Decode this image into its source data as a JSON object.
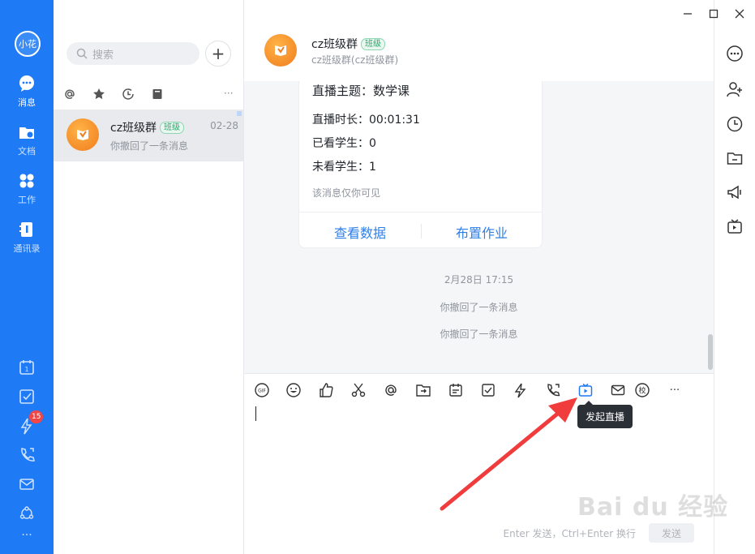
{
  "nav": {
    "avatar": "小花",
    "items": [
      {
        "label": "消息",
        "icon": "chat-bubble-icon",
        "active": true
      },
      {
        "label": "文档",
        "icon": "folder-icon"
      },
      {
        "label": "工作",
        "icon": "grid-apps-icon"
      },
      {
        "label": "通讯录",
        "icon": "contacts-book-icon"
      }
    ],
    "bottom_icons": [
      "calendar-icon",
      "todo-check-icon",
      "lightning-icon",
      "phone-icon",
      "mail-icon",
      "network-icon",
      "more-dots-icon"
    ],
    "calendar_day": "1",
    "badge_count": "15",
    "more": "···"
  },
  "list": {
    "search_placeholder": "搜索",
    "add_label": "+",
    "more_label": "···",
    "session": {
      "name": "cz班级群",
      "tag": "班级",
      "time": "02-28",
      "preview": "你撤回了一条消息"
    }
  },
  "chat": {
    "title": "cz班级群",
    "tag": "班级",
    "subtitle": "cz班级群(cz班级群)",
    "card": {
      "topic": "直播主题：数学课",
      "duration": "直播时长：00:01:31",
      "watched": "已看学生：0",
      "unwatched": "未看学生：1",
      "note": "该消息仅你可见",
      "action_data": "查看数据",
      "action_homework": "布置作业"
    },
    "timestamp": "2月28日 17:15",
    "recall_1": "你撤回了一条消息",
    "recall_2": "你撤回了一条消息",
    "tooltip": "发起直播",
    "hint": "Enter 发送，Ctrl+Enter 换行",
    "send": "发送",
    "gif": "GIF",
    "school": "校",
    "more": "···"
  },
  "watermark": "Bai du 经验",
  "accent": "#1f7af5",
  "arrow_color": "#f03c3c"
}
